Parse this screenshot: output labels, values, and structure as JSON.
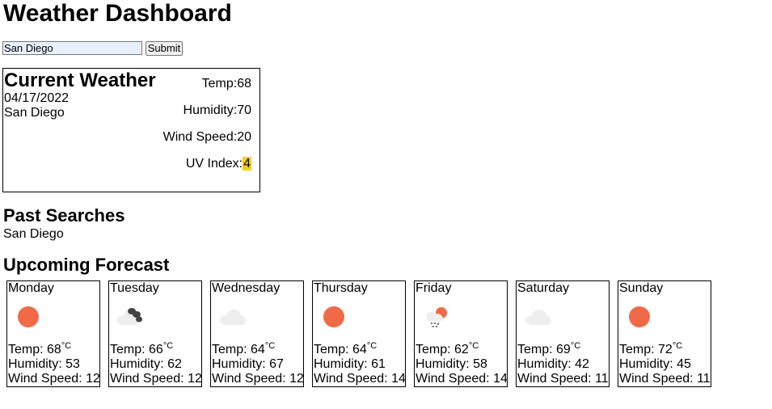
{
  "page": {
    "title": "Weather Dashboard"
  },
  "search": {
    "value": "San Diego",
    "submit_label": "Submit"
  },
  "current": {
    "title": "Current Weather",
    "date": "04/17/2022",
    "city": "San Diego",
    "temp_label": "Temp:",
    "temp": "68",
    "humidity_label": "Humidity:",
    "humidity": "70",
    "wind_label": "Wind Speed:",
    "wind": "20",
    "uv_label": "UV Index:",
    "uv": "4",
    "uv_color": "#f4d40a"
  },
  "past": {
    "title": "Past Searches",
    "items": [
      "San Diego"
    ]
  },
  "forecast": {
    "title": "Upcoming Forecast",
    "temp_label": "Temp: ",
    "unit": "°C",
    "humidity_label": "Humidity: ",
    "wind_label": "Wind Speed: ",
    "days": [
      {
        "day": "Monday",
        "icon": "sun-icon",
        "temp": "68",
        "humidity": "53",
        "wind": "12"
      },
      {
        "day": "Tuesday",
        "icon": "broken-clouds-icon",
        "temp": "66",
        "humidity": "62",
        "wind": "12"
      },
      {
        "day": "Wednesday",
        "icon": "cloud-icon",
        "temp": "64",
        "humidity": "67",
        "wind": "12"
      },
      {
        "day": "Thursday",
        "icon": "sun-icon",
        "temp": "64",
        "humidity": "61",
        "wind": "14"
      },
      {
        "day": "Friday",
        "icon": "rain-sun-icon",
        "temp": "62",
        "humidity": "58",
        "wind": "14"
      },
      {
        "day": "Saturday",
        "icon": "cloud-icon",
        "temp": "69",
        "humidity": "42",
        "wind": "11"
      },
      {
        "day": "Sunday",
        "icon": "sun-icon",
        "temp": "72",
        "humidity": "45",
        "wind": "11"
      }
    ]
  },
  "colors": {
    "sun": "#f06a48",
    "cloud": "#eeeeee",
    "dark_cloud": "#444444",
    "input_bg": "#e8f0fe"
  }
}
